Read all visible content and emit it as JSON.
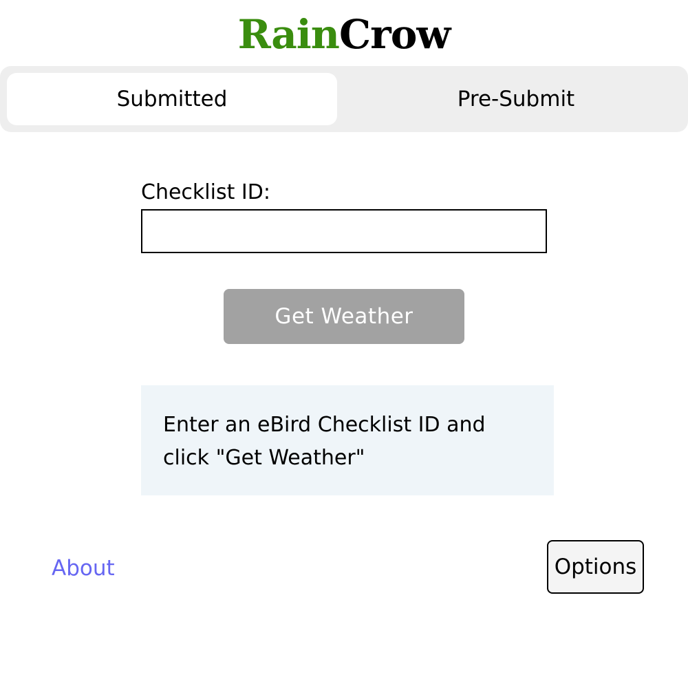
{
  "logo": {
    "rain": "Rain",
    "crow": "Crow",
    "rain_color": "#3a8d0f",
    "crow_color": "#000000"
  },
  "tabs": [
    {
      "label": "Submitted",
      "active": true
    },
    {
      "label": "Pre-Submit",
      "active": false
    }
  ],
  "form": {
    "checklist_label": "Checklist ID:",
    "checklist_value": "",
    "checklist_placeholder": "",
    "submit_label": "Get Weather",
    "submit_color": "#a2a2a2"
  },
  "info": {
    "message": "Enter an eBird Checklist ID and click \"Get Weather\""
  },
  "footer": {
    "about_label": "About",
    "about_color": "#6666f2",
    "options_label": "Options"
  }
}
